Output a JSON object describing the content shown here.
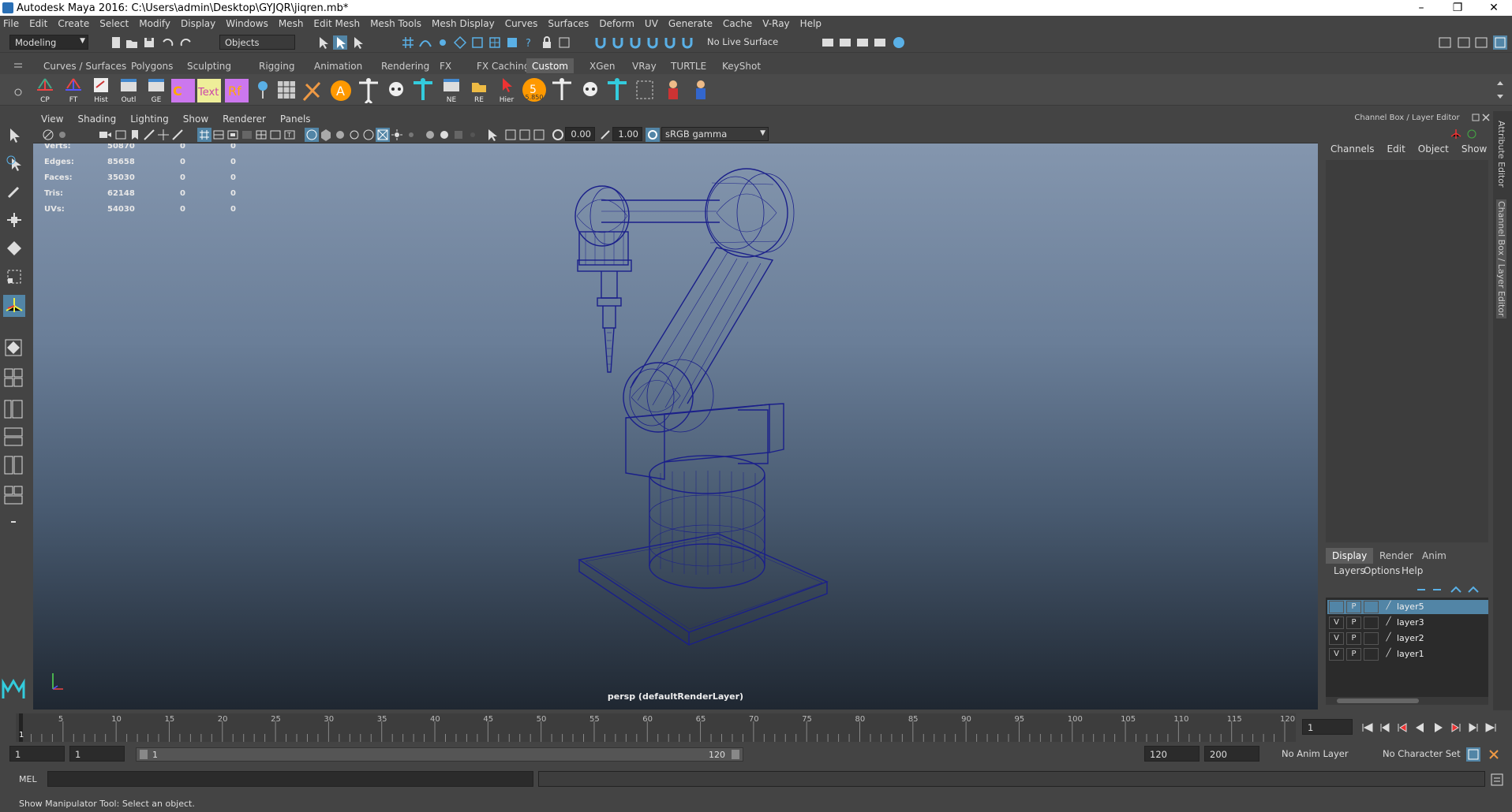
{
  "window": {
    "title": "Autodesk Maya 2016: C:\\Users\\admin\\Desktop\\GYJQR\\jiqren.mb*",
    "minimize": "–",
    "maximize": "❐",
    "close": "✕"
  },
  "menubar": [
    "File",
    "Edit",
    "Create",
    "Select",
    "Modify",
    "Display",
    "Windows",
    "Mesh",
    "Edit Mesh",
    "Mesh Tools",
    "Mesh Display",
    "Curves",
    "Surfaces",
    "Deform",
    "UV",
    "Generate",
    "Cache",
    "V-Ray",
    "Help"
  ],
  "status": {
    "menuset": "Modeling",
    "selmode": "Objects",
    "live_surface": "No Live Surface"
  },
  "shelf_tabs": [
    "Curves / Surfaces",
    "Polygons",
    "Sculpting",
    "Rigging",
    "Animation",
    "Rendering",
    "FX",
    "FX Caching",
    "Custom",
    "XGen",
    "VRay",
    "TURTLE",
    "KeyShot"
  ],
  "shelf_active": "Custom",
  "shelf_labels": [
    "CP",
    "FT",
    "Hist",
    "Outl",
    "GE",
    "NE",
    "RE",
    "Hier",
    "5.850"
  ],
  "viewport_menu": [
    "View",
    "Shading",
    "Lighting",
    "Show",
    "Renderer",
    "Panels"
  ],
  "viewport_toolbar": {
    "exposure": "0.00",
    "gamma": "1.00",
    "colorspace": "sRGB gamma"
  },
  "hud": [
    {
      "label": "Verts:",
      "a": "50870",
      "b": "0",
      "c": "0"
    },
    {
      "label": "Edges:",
      "a": "85658",
      "b": "0",
      "c": "0"
    },
    {
      "label": "Faces:",
      "a": "35030",
      "b": "0",
      "c": "0"
    },
    {
      "label": "Tris:",
      "a": "62148",
      "b": "0",
      "c": "0"
    },
    {
      "label": "UVs:",
      "a": "54030",
      "b": "0",
      "c": "0"
    }
  ],
  "camera_label": "persp (defaultRenderLayer)",
  "channel_box": {
    "title": "Channel Box / Layer Editor",
    "menu": [
      "Channels",
      "Edit",
      "Object",
      "Show"
    ]
  },
  "layer_editor": {
    "tabs": [
      "Display",
      "Render",
      "Anim"
    ],
    "menu": [
      "Layers",
      "Options",
      "Help"
    ],
    "layers": [
      {
        "name": "layer5",
        "v": "",
        "p": "P"
      },
      {
        "name": "layer3",
        "v": "V",
        "p": "P"
      },
      {
        "name": "layer2",
        "v": "V",
        "p": "P"
      },
      {
        "name": "layer1",
        "v": "V",
        "p": "P"
      }
    ]
  },
  "side_tabs": [
    "Attribute Editor",
    "Channel Box / Layer Editor"
  ],
  "timeline": {
    "ticks": [
      "5",
      "10",
      "15",
      "20",
      "25",
      "30",
      "35",
      "40",
      "45",
      "50",
      "55",
      "60",
      "65",
      "70",
      "75",
      "80",
      "85",
      "90",
      "95",
      "100",
      "105",
      "110",
      "115",
      "120"
    ],
    "current": "1",
    "current_field": "1"
  },
  "range": {
    "start": "1",
    "anim_start": "1",
    "slider_start": "1",
    "slider_end": "120",
    "end": "120",
    "anim_end": "200",
    "anim_layer": "No Anim Layer",
    "char_set": "No Character Set"
  },
  "cmd": {
    "lang": "MEL"
  },
  "help_line": "Show Manipulator Tool: Select an object."
}
